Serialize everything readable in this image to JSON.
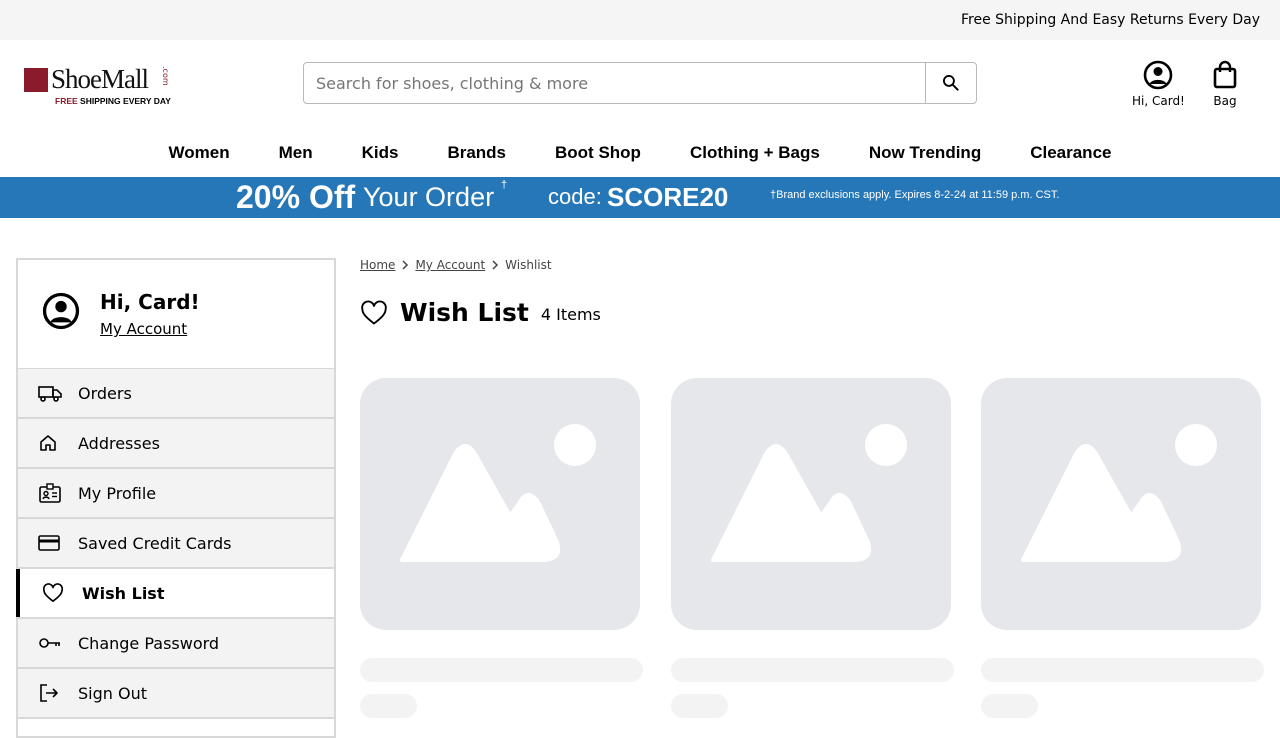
{
  "topbar": {
    "message": "Free Shipping And Easy Returns Every Day"
  },
  "logo": {
    "wordmark": "ShoeMall",
    "dotcom": ".com",
    "tagline_free": "FREE",
    "tagline_rest": "SHIPPING EVERY DAY"
  },
  "search": {
    "placeholder": "Search for shoes, clothing & more",
    "icon": "search-icon"
  },
  "header": {
    "account_label": "Hi, Card!",
    "bag_label": "Bag"
  },
  "nav": {
    "items": [
      "Women",
      "Men",
      "Kids",
      "Brands",
      "Boot Shop",
      "Clothing + Bags",
      "Now Trending",
      "Clearance"
    ]
  },
  "promo": {
    "percent": "20% Off",
    "rest": "Your Order",
    "dagger": "†",
    "code_label": "code:",
    "code_value": "SCORE20",
    "fine_print": "†Brand exclusions apply. Expires 8-2-24 at 11:59 p.m. CST.",
    "color": "#2677b8"
  },
  "sidebar": {
    "greeting": "Hi, Card!",
    "account_link": "My Account",
    "items": [
      {
        "label": "Orders",
        "icon": "truck-icon"
      },
      {
        "label": "Addresses",
        "icon": "home-icon"
      },
      {
        "label": "My Profile",
        "icon": "id-card-icon"
      },
      {
        "label": "Saved Credit Cards",
        "icon": "credit-card-icon"
      },
      {
        "label": "Wish List",
        "icon": "heart-icon",
        "active": true
      },
      {
        "label": "Change Password",
        "icon": "key-icon"
      },
      {
        "label": "Sign Out",
        "icon": "sign-out-icon"
      }
    ]
  },
  "breadcrumb": {
    "home": "Home",
    "account": "My Account",
    "current": "Wishlist"
  },
  "wishlist": {
    "title": "Wish List",
    "count": "4 Items"
  }
}
